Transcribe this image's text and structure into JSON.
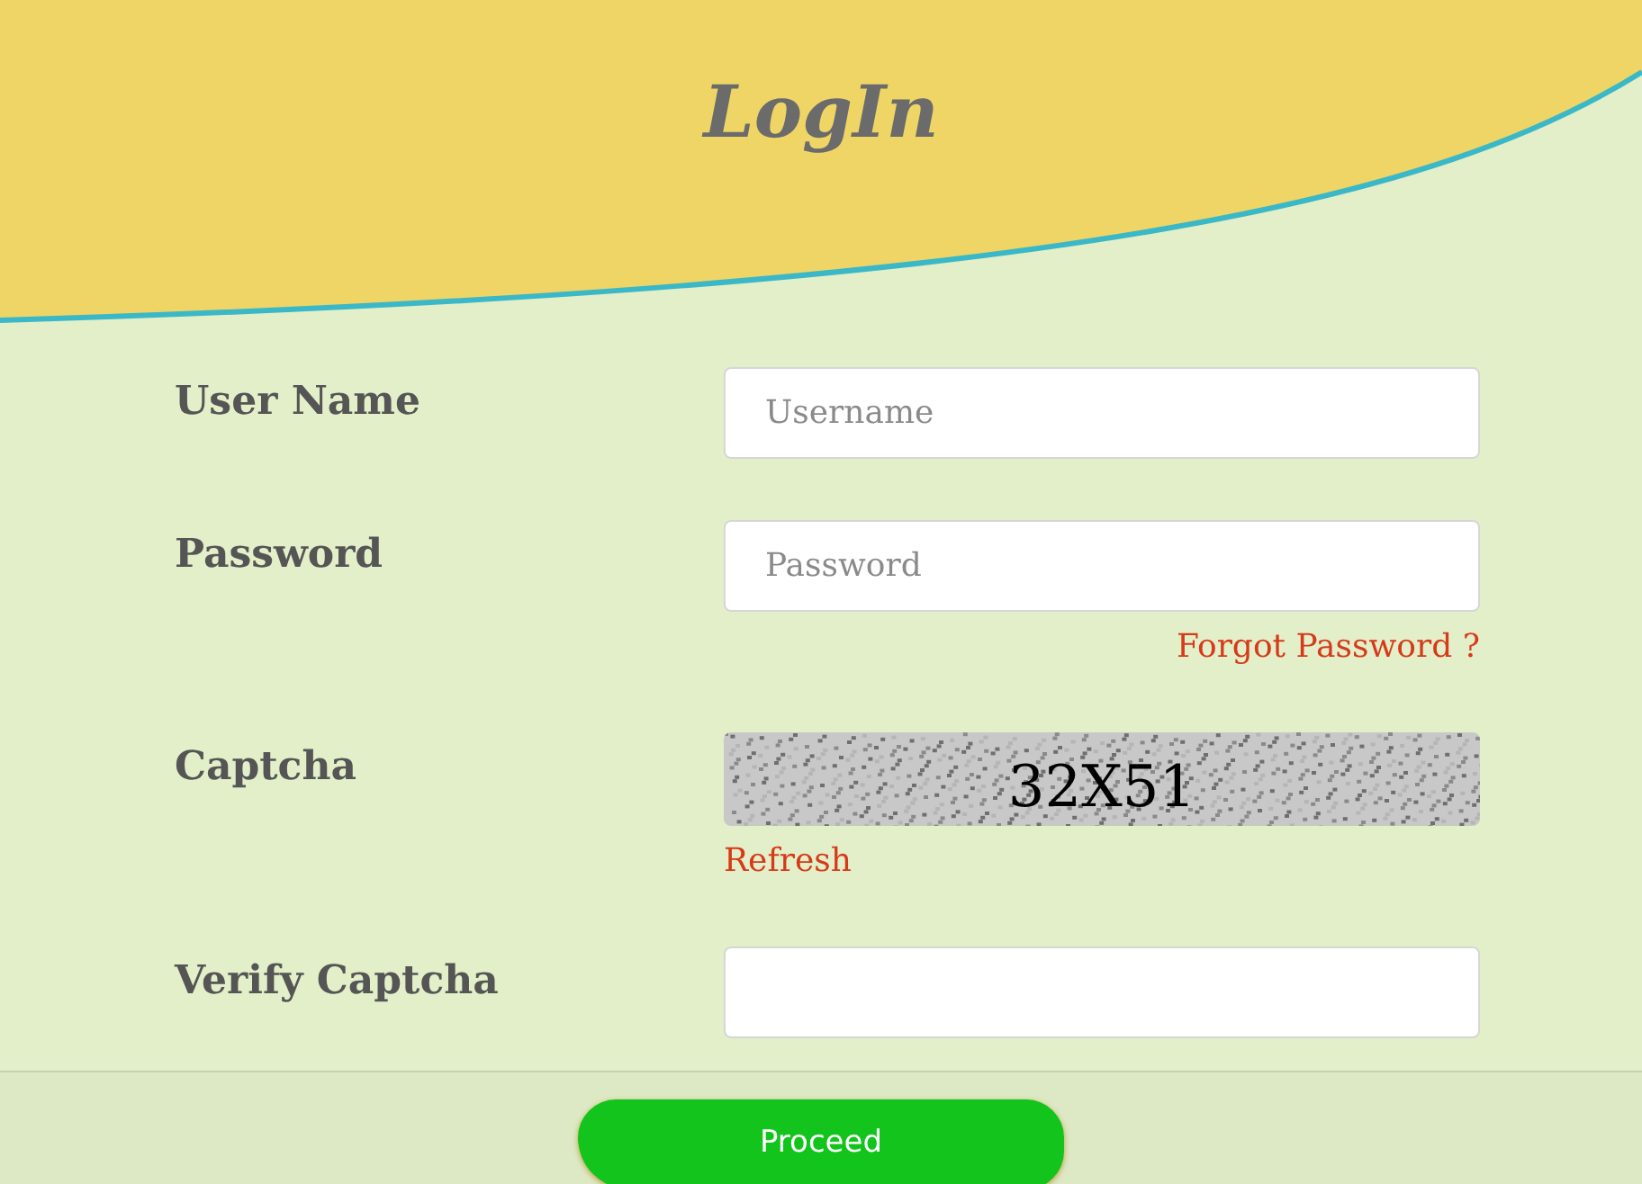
{
  "title": "LogIn",
  "fields": [
    {
      "label": "User Name",
      "kind": "input",
      "placeholder": "Username"
    },
    {
      "label": "Password",
      "kind": "input",
      "placeholder": "Password",
      "link": "Forgot Password ?"
    },
    {
      "label": "Captcha",
      "kind": "captcha",
      "code": "32X51",
      "link": "Refresh"
    },
    {
      "label": "Verify Captcha",
      "kind": "input"
    }
  ],
  "submit": "Proceed"
}
